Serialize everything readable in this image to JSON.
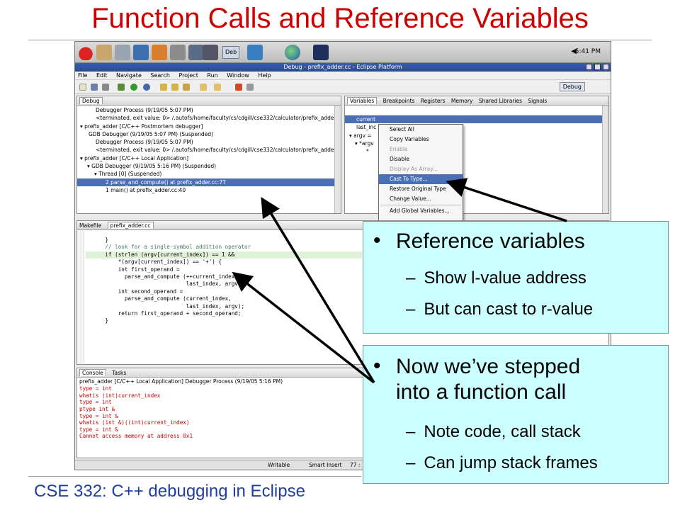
{
  "slide": {
    "title": "Function Calls and Reference Variables",
    "footer": "CSE 332: C++ debugging in Eclipse"
  },
  "taskbar": {
    "deb_button": "Deb",
    "clock": "5:41 PM"
  },
  "window": {
    "title": "Debug - prefix_adder.cc - Eclipse Platform"
  },
  "menu": [
    "File",
    "Edit",
    "Navigate",
    "Search",
    "Project",
    "Run",
    "Window",
    "Help"
  ],
  "toolbar": {
    "perspective_label": "Debug"
  },
  "debug_view": {
    "tab": "Debug",
    "rows": [
      "Debugger Process (9/19/05 5:07 PM)",
      "<terminated, exit value: 0> /.autofs/home/faculty/cs/cdgill/cse332/calculator/prefix_adder (9/19/0",
      "prefix_adder [C/C++ Postmortem debugger]",
      "GDB Debugger (9/19/05 5:07 PM) (Suspended)",
      "Debugger Process (9/19/05 5:07 PM)",
      "<terminated, exit value: 0> /.autofs/home/faculty/cs/cdgill/cse332/calculator/prefix_adder (9/19/0",
      "prefix_adder [C/C++ Local Application]",
      "GDB Debugger (9/19/05 5:16 PM) (Suspended)",
      "Thread [0] (Suspended)",
      "2 parse_and_compute() at prefix_adder.cc:77",
      "1 main() at prefix_adder.cc:40"
    ]
  },
  "variables_view": {
    "tabs": [
      "Variables",
      "Breakpoints",
      "Registers",
      "Memory",
      "Shared Libraries",
      "Signals"
    ],
    "rows": [
      "current",
      "last_inc",
      "argv =",
      "*argv",
      "*"
    ]
  },
  "context_menu": {
    "items": [
      {
        "label": "Select All",
        "disabled": false
      },
      {
        "label": "Copy Variables",
        "disabled": false
      },
      {
        "label": "Enable",
        "disabled": true
      },
      {
        "label": "Disable",
        "disabled": false
      },
      {
        "label": "Display As Array...",
        "disabled": true
      },
      {
        "label": "Cast To Type...",
        "disabled": false,
        "highlighted": true
      },
      {
        "label": "Restore Original Type",
        "disabled": false
      },
      {
        "label": "Change Value...",
        "disabled": false
      },
      {
        "label": "Add Global Variables...",
        "disabled": false
      }
    ]
  },
  "editor": {
    "tabs": [
      "Makefile",
      "prefix_adder.cc"
    ],
    "lines": [
      "      }",
      "",
      "      // look for a single-symbol addition operator",
      "      if (strlen (argv[current_index]) == 1 &&",
      "          *(argv[current_index]) == '+') {",
      "",
      "          int first_operand =",
      "            parse_and_compute (++current_index,",
      "                               last_index, argv);",
      "",
      "          int second_operand =",
      "            parse_and_compute (current_index,",
      "                               last_index, argv);",
      "",
      "          return first_operand + second_operand;",
      "      }"
    ]
  },
  "console": {
    "tabs": [
      "Console",
      "Tasks"
    ],
    "header": "prefix_adder [C/C++ Local Application] Debugger Process (9/19/05 5:16 PM)",
    "lines": [
      "type = int",
      "whatis (int)current_index",
      "type = int",
      "ptype int &",
      "type = int &",
      "whatis (int &)((int)current_index)",
      "type = int &",
      "Cannot access memory at address 0x1"
    ]
  },
  "statusbar": {
    "writable": "Writable",
    "insert_mode": "Smart Insert",
    "position": "77 :"
  },
  "callouts": {
    "box1": {
      "bullet": "Reference variables",
      "subs": [
        "Show l-value address",
        "But can cast to r-value"
      ]
    },
    "box2": {
      "bullet_line1": "Now we’ve stepped",
      "bullet_line2": "into a function call",
      "subs": [
        "Note code, call stack",
        "Can jump stack frames"
      ]
    }
  },
  "colors": {
    "title": "#cc0000",
    "footer": "#1f3fa0",
    "callout_bg": "#ccffff",
    "selection": "#4a6fb5",
    "console_text": "#c80000"
  }
}
